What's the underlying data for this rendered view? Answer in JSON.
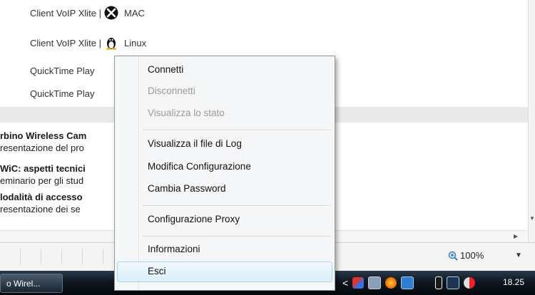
{
  "downloads": [
    {
      "label": "Client VoIP Xlite |",
      "os": "MAC",
      "icon": "apple-x-icon"
    },
    {
      "label": "Client VoIP Xlite |",
      "os": "Linux",
      "icon": "linux-tux-icon"
    },
    {
      "label": "QuickTime Play",
      "os": "",
      "icon": ""
    },
    {
      "label": "QuickTime Play",
      "os": "",
      "icon": ""
    }
  ],
  "news": [
    {
      "title": "rbino Wireless Cam",
      "desc": "resentazione del pro"
    },
    {
      "title": "WiC: aspetti tecnici",
      "desc": "eminario per gli stud"
    },
    {
      "title": "lodalità di accesso",
      "desc": "resentazione dei se"
    }
  ],
  "context_menu": {
    "items": [
      {
        "label": "Connetti",
        "enabled": true
      },
      {
        "label": "Disconnetti",
        "enabled": false
      },
      {
        "label": "Visualizza lo stato",
        "enabled": false
      },
      {
        "label": "Visualizza il file di Log",
        "enabled": true
      },
      {
        "label": "Modifica Configurazione",
        "enabled": true
      },
      {
        "label": "Cambia Password",
        "enabled": true
      },
      {
        "label": "Configurazione Proxy",
        "enabled": true
      },
      {
        "label": "Informazioni",
        "enabled": true
      },
      {
        "label": "Esci",
        "enabled": true,
        "highlighted": true
      }
    ]
  },
  "statusbar": {
    "zoom": "100%"
  },
  "taskbar": {
    "task_label": "o Wirel...",
    "clock": "18.25"
  },
  "colors": {
    "highlight_border": "#a8d8eb",
    "taskbar": "#0f1720"
  }
}
